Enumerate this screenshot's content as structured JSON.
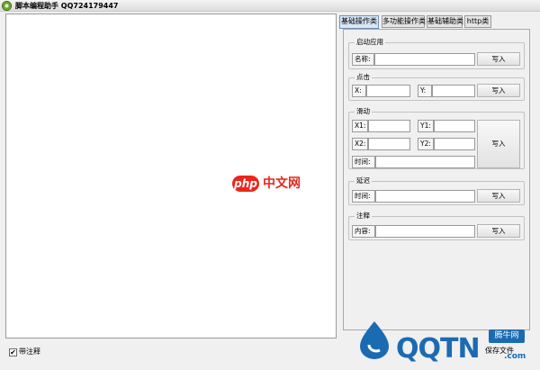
{
  "window": {
    "title": "脚本编程助手 QQ724179447"
  },
  "tabs": [
    {
      "label": "基础操作类",
      "active": true
    },
    {
      "label": "多功能操作类",
      "active": false
    },
    {
      "label": "基础辅助类",
      "active": false
    },
    {
      "label": "http类",
      "active": false
    }
  ],
  "groups": {
    "launch": {
      "title": "启动应用",
      "name_label": "名称:",
      "write": "写入"
    },
    "click": {
      "title": "点击",
      "x_label": "X:",
      "y_label": "Y:",
      "write": "写入"
    },
    "slide": {
      "title": "滑动",
      "x1_label": "X1:",
      "y1_label": "Y1:",
      "x2_label": "X2:",
      "y2_label": "Y2:",
      "time_label": "时间:",
      "write": "写入"
    },
    "delay": {
      "title": "延迟",
      "time_label": "时间:",
      "write": "写入"
    },
    "note": {
      "title": "注释",
      "content_label": "内容:",
      "write": "写入"
    }
  },
  "bottom": {
    "with_comments": "带注释",
    "with_comments_checked": true,
    "check_mark": "✔",
    "save_file": "保存文件"
  },
  "watermarks": {
    "php_badge": "php",
    "php_site": "中文网",
    "qqtn_logo": "QQTN",
    "qqtn_com": ".com",
    "qqtn_badge": "腾牛网"
  },
  "colors": {
    "watermark_red": "#e9261c",
    "watermark_blue": "#1b6bb3"
  }
}
